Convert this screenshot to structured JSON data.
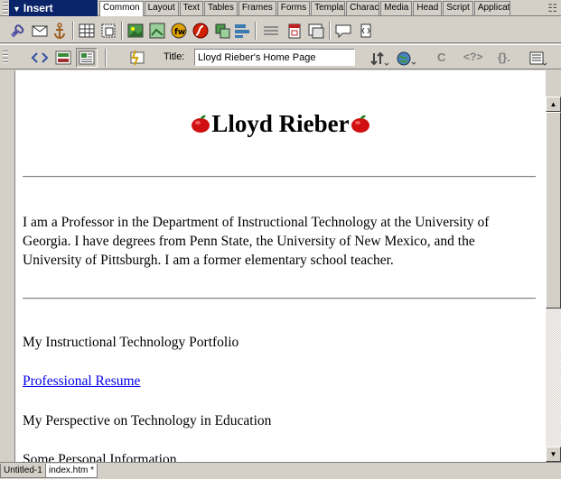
{
  "insert_panel": {
    "title": "Insert",
    "tabs": [
      "Common",
      "Layout",
      "Text",
      "Tables",
      "Frames",
      "Forms",
      "Templat",
      "Charact",
      "Media",
      "Head",
      "Script",
      "Applicat"
    ],
    "active_tab": "Common"
  },
  "insert_icons": [
    "hyperlink-icon",
    "email-link-icon",
    "named-anchor-icon",
    "table-icon",
    "draw-layer-icon",
    "image-icon",
    "image-placeholder-icon",
    "fireworks-html-icon",
    "flash-icon",
    "rollover-image-icon",
    "navigation-bar-icon",
    "horizontal-rule-icon",
    "date-icon",
    "tabular-data-icon",
    "comment-icon",
    "tag-chooser-icon"
  ],
  "doc_toolbar": {
    "title_label": "Title:",
    "title_value": "Lloyd Rieber's Home Page"
  },
  "document": {
    "heading": "Lloyd Rieber",
    "paragraph": "I am a Professor in the Department of Instructional Technology at the University of Georgia. I have degrees from Penn State, the University of New Mexico, and the University of Pittsburgh. I am a former elementary school teacher.",
    "items": [
      {
        "text": "My Instructional Technology Portfolio",
        "link": false
      },
      {
        "text": "Professional Resume",
        "link": true
      },
      {
        "text": "My Perspective on Technology in Education",
        "link": false
      },
      {
        "text": "Some Personal Information",
        "link": false
      }
    ]
  },
  "doc_tabs": [
    "Untitled-1",
    "index.htm *"
  ],
  "colors": {
    "title_bar": "#0a246a",
    "link": "#0000ee",
    "chrome": "#d4d0c8"
  }
}
